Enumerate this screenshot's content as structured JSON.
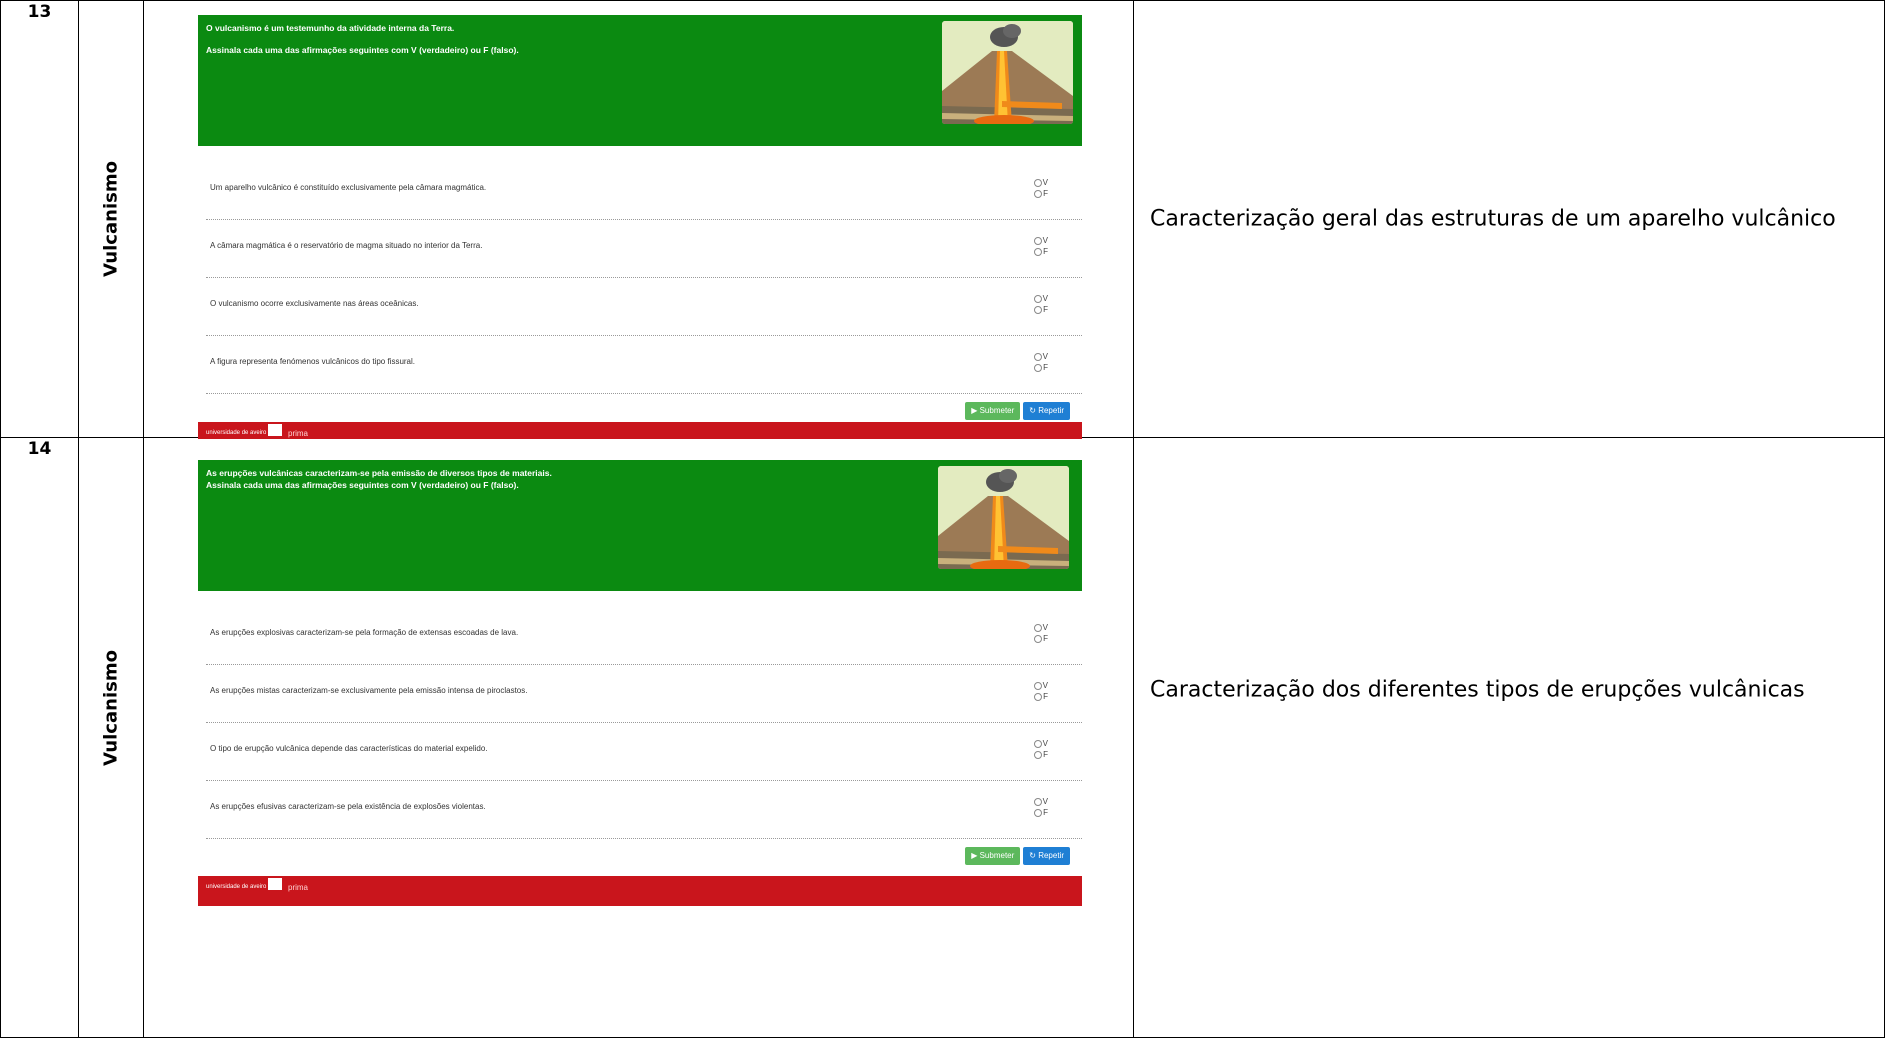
{
  "rows": [
    {
      "number": "13",
      "theme": "Vulcanismo",
      "description": "Caracterização geral das estruturas de um aparelho vulcânico",
      "quiz": {
        "header_line1": "O vulcanismo é um testemunho da atividade interna da Terra.",
        "header_line2": "Assinala cada uma das afirmações seguintes com V (verdadeiro) ou F (falso).",
        "statements": [
          "Um aparelho vulcânico é constituído exclusivamente pela câmara magmática.",
          "A câmara magmática é o reservatório de magma situado no interior da Terra.",
          "O vulcanismo ocorre exclusivamente nas áreas oceânicas.",
          "A figura representa fenómenos vulcânicos do tipo fissural."
        ],
        "option_v": "V",
        "option_f": "F",
        "submit_label": "▶ Submeter",
        "redo_label": "↻ Repetir",
        "footer_uni": "universidade de aveiro",
        "footer_brand": "prima"
      }
    },
    {
      "number": "14",
      "theme": "Vulcanismo",
      "description": "Caracterização dos diferentes tipos de erupções vulcânicas",
      "quiz": {
        "header_line1": "As erupções vulcânicas caracterizam-se pela emissão de diversos tipos de materiais.",
        "header_line2": "Assinala cada uma das afirmações seguintes com V (verdadeiro) ou F (falso).",
        "statements": [
          "As erupções explosivas caracterizam-se pela formação de extensas escoadas de lava.",
          "As erupções mistas caracterizam-se exclusivamente pela emissão intensa de piroclastos.",
          "O tipo de erupção vulcânica depende das características do material expelido.",
          "As erupções efusivas caracterizam-se pela existência de explosões violentas."
        ],
        "option_v": "V",
        "option_f": "F",
        "submit_label": "▶ Submeter",
        "redo_label": "↻ Repetir",
        "footer_uni": "universidade de aveiro",
        "footer_brand": "prima"
      }
    }
  ],
  "colors": {
    "header_green": "#0b8a11",
    "footer_red": "#c9151c",
    "submit_green": "#5cb85c",
    "redo_blue": "#1f7fd4"
  }
}
